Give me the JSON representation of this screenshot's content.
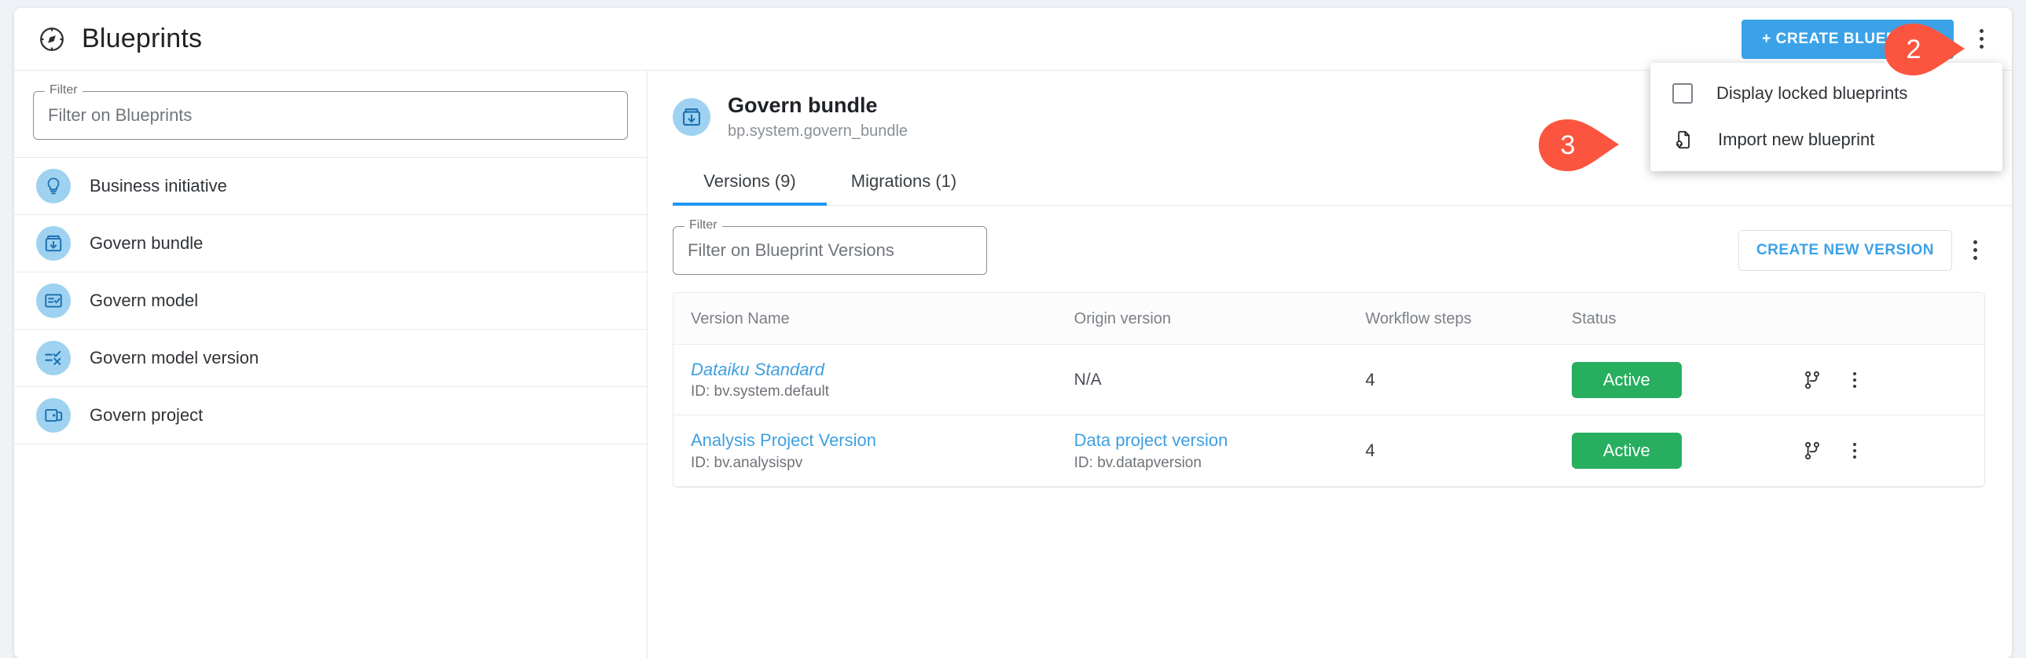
{
  "header": {
    "title": "Blueprints",
    "icon": "blueprints-compass-icon",
    "create_button": "+ CREATE BLUEPRINT",
    "overflow_icon": "vertical-dots-icon"
  },
  "sidebar": {
    "filter": {
      "label": "Filter",
      "placeholder": "Filter on Blueprints",
      "value": ""
    },
    "items": [
      {
        "label": "Business initiative",
        "icon": "lightbulb-icon"
      },
      {
        "label": "Govern bundle",
        "icon": "bundle-download-icon"
      },
      {
        "label": "Govern model",
        "icon": "model-check-icon"
      },
      {
        "label": "Govern model version",
        "icon": "model-version-icon"
      },
      {
        "label": "Govern project",
        "icon": "project-folder-icon"
      }
    ]
  },
  "main": {
    "bundle": {
      "title": "Govern bundle",
      "subtitle": "bp.system.govern_bundle",
      "icon": "bundle-download-icon"
    },
    "tabs": [
      {
        "label": "Versions (9)",
        "active": true
      },
      {
        "label": "Migrations (1)",
        "active": false
      }
    ],
    "toolbar": {
      "filter": {
        "label": "Filter",
        "placeholder": "Filter on Blueprint Versions",
        "value": ""
      },
      "create_version_button": "CREATE NEW VERSION",
      "overflow_icon": "vertical-dots-icon"
    },
    "table": {
      "columns": [
        "Version Name",
        "Origin version",
        "Workflow steps",
        "Status"
      ],
      "rows": [
        {
          "name": "Dataiku Standard",
          "name_italic": true,
          "id": "ID: bv.system.default",
          "origin": "N/A",
          "origin_is_link": false,
          "origin_id": "",
          "steps": "4",
          "status": "Active",
          "branch_icon": "git-branch-icon",
          "menu_icon": "vertical-dots-icon"
        },
        {
          "name": "Analysis Project Version",
          "name_italic": false,
          "id": "ID: bv.analysispv",
          "origin": "Data project version",
          "origin_is_link": true,
          "origin_id": "ID: bv.datapversion",
          "steps": "4",
          "status": "Active",
          "branch_icon": "git-branch-icon",
          "menu_icon": "vertical-dots-icon"
        }
      ]
    }
  },
  "dropdown": {
    "items": [
      {
        "label": "Display locked blueprints",
        "icon": "checkbox-unchecked-icon",
        "checked": false
      },
      {
        "label": "Import new blueprint",
        "icon": "file-upload-icon"
      }
    ]
  },
  "callouts": [
    {
      "number": "2"
    },
    {
      "number": "3"
    }
  ],
  "colors": {
    "accent_blue": "#3ba2e8",
    "tab_underline": "#2196f3",
    "status_green": "#27ae5f",
    "icon_circle": "#9ed2f0",
    "icon_glyph": "#1c6fb0",
    "callout_red": "#fb5540",
    "link_blue": "#3f9fdf"
  }
}
